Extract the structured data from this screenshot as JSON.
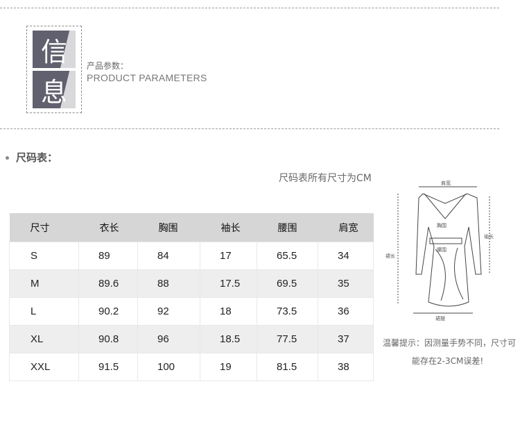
{
  "logo": {
    "char_top": "信",
    "char_bottom": "息"
  },
  "params": {
    "label_cn": "产品参数：",
    "label_en": "PRODUCT PARAMETERS"
  },
  "section": {
    "title": "尺码表：",
    "note": "尺码表所有尺寸为CM"
  },
  "table": {
    "headers": [
      "尺寸",
      "衣长",
      "胸围",
      "袖长",
      "腰围",
      "肩宽"
    ],
    "rows": [
      [
        "S",
        "89",
        "84",
        "17",
        "65.5",
        "34"
      ],
      [
        "M",
        "89.6",
        "88",
        "17.5",
        "69.5",
        "35"
      ],
      [
        "L",
        "90.2",
        "92",
        "18",
        "73.5",
        "36"
      ],
      [
        "XL",
        "90.8",
        "96",
        "18.5",
        "77.5",
        "37"
      ],
      [
        "XXL",
        "91.5",
        "100",
        "19",
        "81.5",
        "38"
      ]
    ]
  },
  "diagram": {
    "shoulder": "肩宽",
    "chest": "胸围",
    "waist": "腰围",
    "sleeve": "袖长",
    "length": "裙长",
    "hem": "裙摆"
  },
  "tips": {
    "line1": "温馨提示：因测量手势不同，尺寸可",
    "line2": "能存在2-3CM误差!"
  },
  "colors": {
    "tile": "#61606e",
    "header_bg": "#d6d6d6",
    "alt_row": "#eeeeee"
  }
}
